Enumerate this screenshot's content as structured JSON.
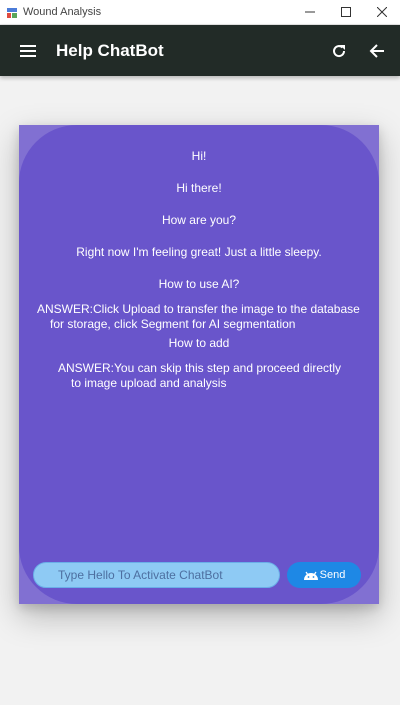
{
  "window": {
    "title": "Wound Analysis",
    "controls": {
      "minimize": "—",
      "maximize": "☐",
      "close": "✕"
    }
  },
  "appbar": {
    "title": "Help ChatBot",
    "background": "#222b27"
  },
  "chat": {
    "messages": [
      {
        "text": "Hi!"
      },
      {
        "text": "Hi there!"
      },
      {
        "text": "How are you?"
      },
      {
        "text": "Right now I'm feeling great! Just a little sleepy."
      },
      {
        "text": "How to use AI?"
      },
      {
        "line1": "ANSWER:Click Upload to transfer the image to the database",
        "line2": "for storage, click Segment for AI segmentation"
      },
      {
        "text": "How to add"
      },
      {
        "line1": "ANSWER:You can skip this step and proceed directly",
        "line2": "to image upload and analysis"
      }
    ],
    "input": {
      "placeholder": "Type Hello To Activate ChatBot"
    },
    "send_label": "Send"
  },
  "colors": {
    "card": "#6955cb",
    "input": "#8ecaf4",
    "send": "#1e88e5"
  },
  "icons": [
    "menu-icon",
    "refresh-icon",
    "back-arrow-icon",
    "android-icon"
  ]
}
